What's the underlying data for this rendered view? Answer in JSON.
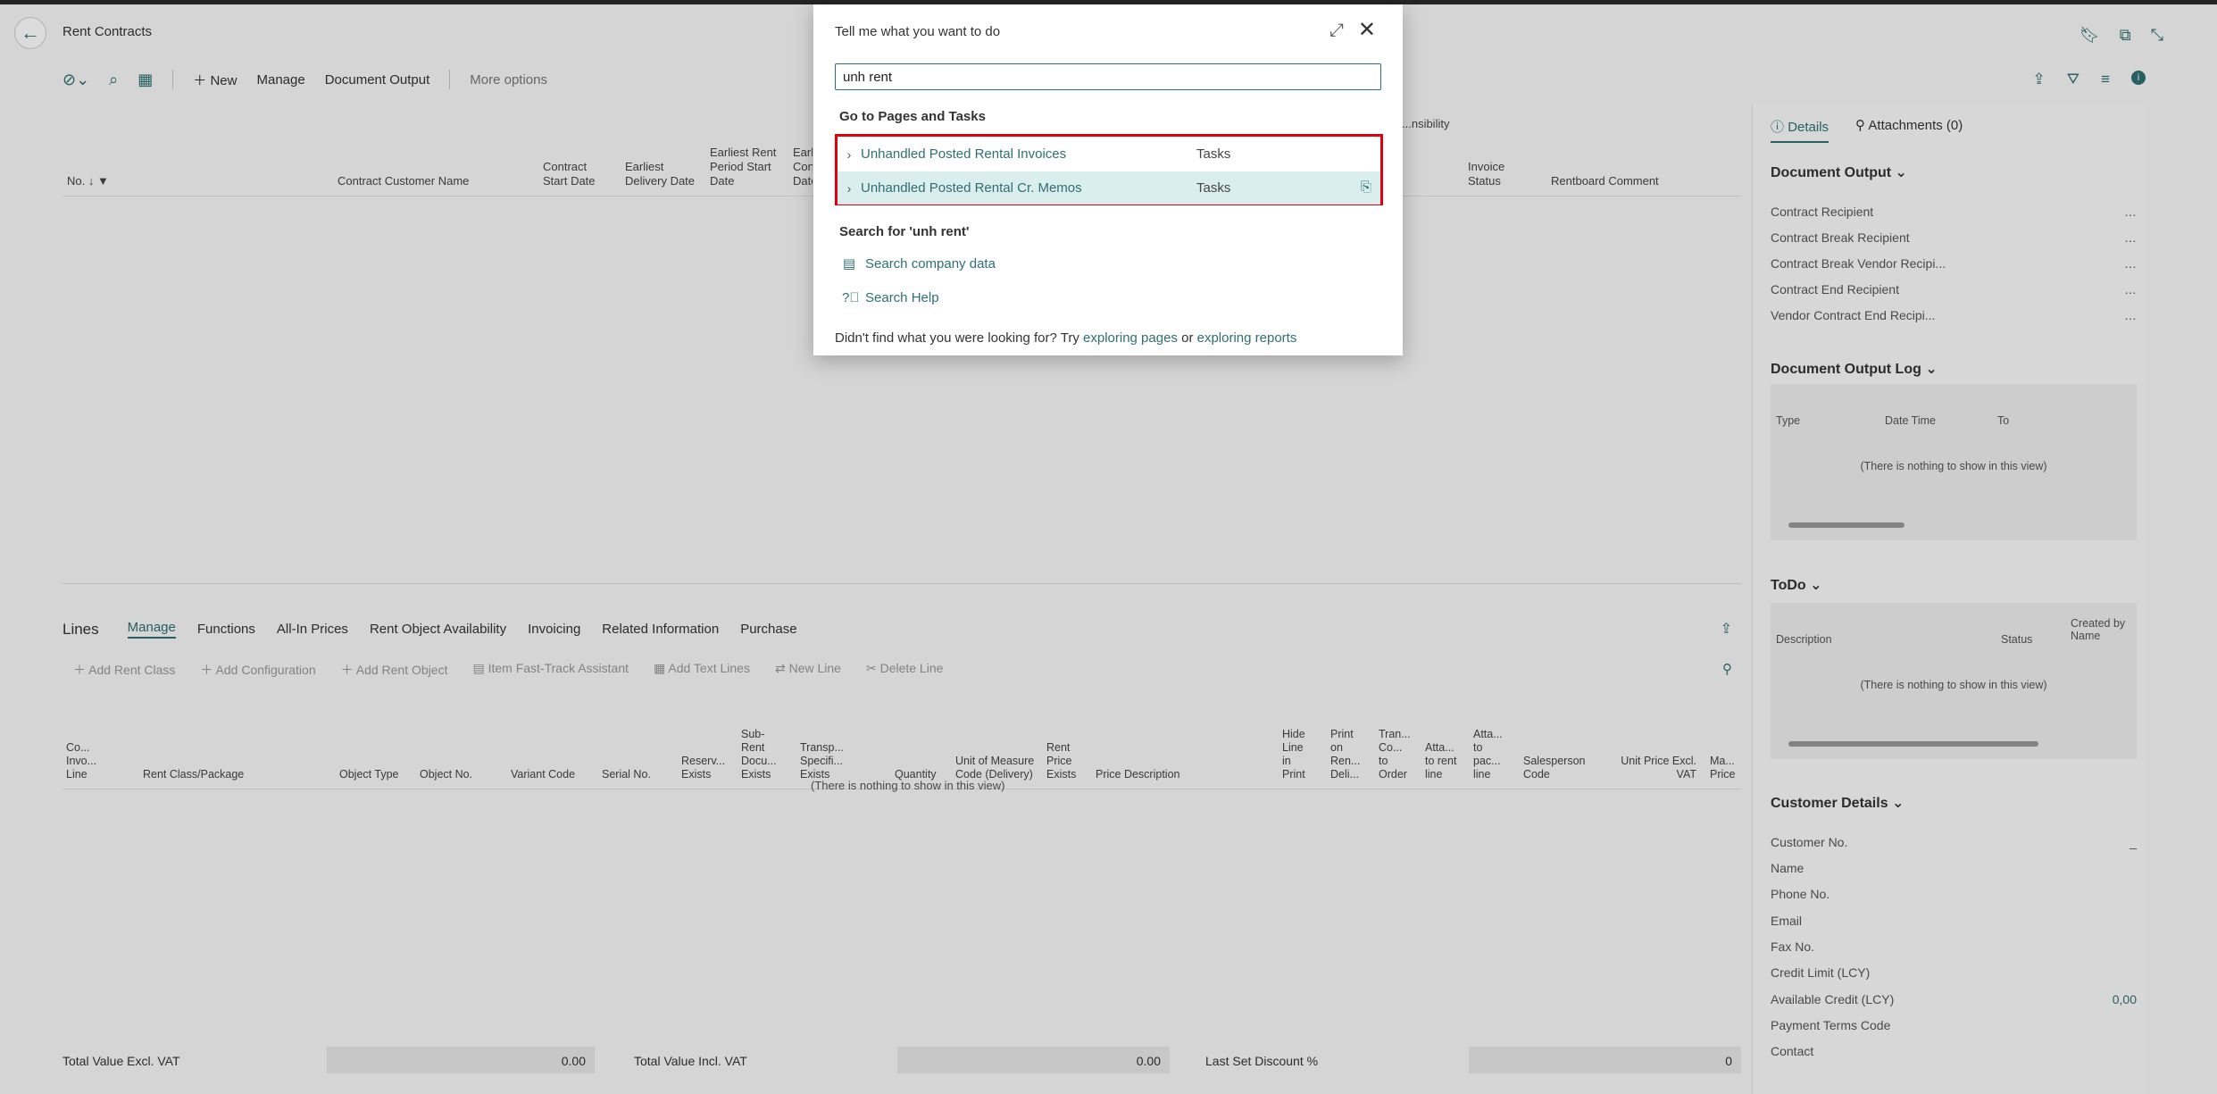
{
  "app": {
    "page_title": "Rent Contracts",
    "toolbar": {
      "new": "New",
      "manage": "Manage",
      "document_output": "Document Output",
      "more_options": "More options"
    },
    "list_columns": [
      {
        "label": "No. ↓"
      },
      {
        "label": "Contract Customer Name"
      },
      {
        "label": "Contract Start Date"
      },
      {
        "label": "Earliest Delivery Date"
      },
      {
        "label": "Earliest Rent Period Start Date"
      },
      {
        "label": "Earli Cont Date"
      },
      {
        "label": "...nsibility"
      },
      {
        "label": "Invoice Status"
      },
      {
        "label": "Rentboard Comment"
      }
    ],
    "lines": {
      "title": "Lines",
      "tabs": [
        "Manage",
        "Functions",
        "All-In Prices",
        "Rent Object Availability",
        "Invoicing",
        "Related Information",
        "Purchase"
      ],
      "actions": [
        "Add Rent Class",
        "Add Configuration",
        "Add Rent Object",
        "Item Fast-Track Assistant",
        "Add Text Lines",
        "New Line",
        "Delete Line"
      ],
      "columns": [
        "Co... Invo... Line",
        "Rent Class/Package",
        "Object Type",
        "Object No.",
        "Variant Code",
        "Serial No.",
        "Reserv... Exists",
        "Sub-Rent Docu... Exists",
        "Transp... Specifi... Exists",
        "Quantity",
        "Unit of Measure Code (Delivery)",
        "Rent Price Exists",
        "Price Description",
        "Hide Line in Print",
        "Print on Ren... Deli...",
        "Tran... Co... to Order",
        "Atta... to rent line",
        "Atta... to pac... line",
        "Salesperson Code",
        "Unit Price Excl. VAT",
        "Ma... Price"
      ],
      "empty": "(There is nothing to show in this view)"
    },
    "totals": {
      "excl_label": "Total Value Excl. VAT",
      "excl_value": "0.00",
      "incl_label": "Total Value Incl. VAT",
      "incl_value": "0.00",
      "discount_label": "Last Set Discount %",
      "discount_value": "0"
    },
    "factbox": {
      "tab_details": "Details",
      "tab_attachments": "Attachments (0)",
      "doc_output_title": "Document Output",
      "doc_output_rows": [
        "Contract Recipient",
        "Contract Break Recipient",
        "Contract Break Vendor Recipi...",
        "Contract End Recipient",
        "Vendor Contract End Recipi..."
      ],
      "log_title": "Document Output Log",
      "log_cols": {
        "type": "Type",
        "datetime": "Date Time",
        "to": "To"
      },
      "log_empty": "(There is nothing to show in this view)",
      "todo_title": "ToDo",
      "todo_cols": {
        "description": "Description",
        "status": "Status",
        "created_by": "Created by Name"
      },
      "todo_empty": "(There is nothing to show in this view)",
      "customer_title": "Customer Details",
      "customer_rows": [
        "Customer No.",
        "Name",
        "Phone No.",
        "Email",
        "Fax No.",
        "Credit Limit (LCY)",
        "Available Credit (LCY)",
        "Payment Terms Code",
        "Contact"
      ],
      "customer_no_value": "_",
      "available_credit_value": "0,00"
    }
  },
  "dialog": {
    "title": "Tell me what you want to do",
    "search_value": "unh rent",
    "pages_section": "Go to Pages and Tasks",
    "results": [
      {
        "name": "Unhandled Posted Rental Invoices",
        "kind": "Tasks"
      },
      {
        "name": "Unhandled Posted Rental Cr. Memos",
        "kind": "Tasks"
      }
    ],
    "search_section": "Search for 'unh rent'",
    "search_company": "Search company data",
    "search_help": "Search Help",
    "footer_prefix": "Didn't find what you were looking for? Try",
    "footer_link1": "exploring pages",
    "footer_or": "or",
    "footer_link2": "exploring reports"
  },
  "colors": {
    "accent": "#2f6f73",
    "highlight_border": "#e00010",
    "selected_row": "#dbeeee"
  }
}
